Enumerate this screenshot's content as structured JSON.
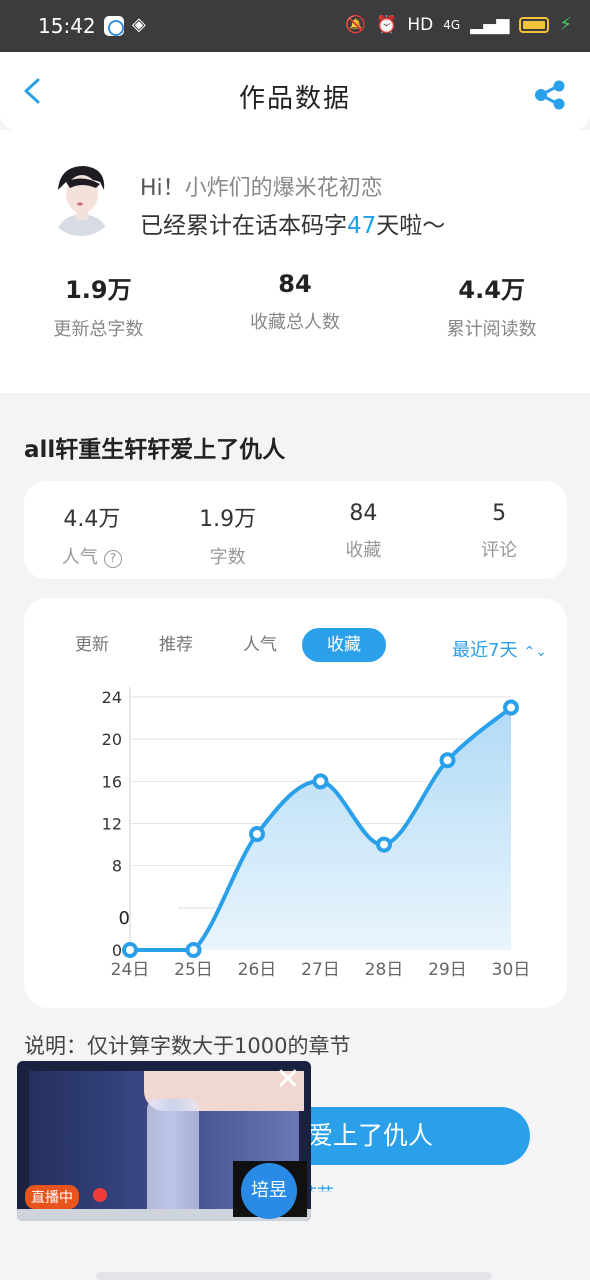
{
  "status_bar": {
    "time": "15:42",
    "network": "HD",
    "signal": "4G"
  },
  "nav": {
    "title": "作品数据"
  },
  "profile": {
    "greeting_prefix": "Hi！",
    "nickname": "小炸们的爆米花初恋",
    "days_prefix": "已经累计在话本码字",
    "days": "47",
    "days_suffix": "天啦～",
    "stats": [
      {
        "value": "1.9万",
        "label": "更新总字数"
      },
      {
        "value": "84",
        "label": "收藏总人数"
      },
      {
        "value": "4.4万",
        "label": "累计阅读数"
      }
    ]
  },
  "work": {
    "title": "all轩重生轩轩爱上了仇人",
    "stats": [
      {
        "value": "4.4万",
        "label": "人气"
      },
      {
        "value": "1.9万",
        "label": "字数"
      },
      {
        "value": "84",
        "label": "收藏"
      },
      {
        "value": "5",
        "label": "评论"
      }
    ]
  },
  "chart_tabs": [
    "更新",
    "推荐",
    "人气",
    "收藏"
  ],
  "active_tab": "收藏",
  "range_label": "最近7天",
  "chart_data": {
    "type": "area",
    "x": [
      "24日",
      "25日",
      "26日",
      "27日",
      "28日",
      "29日",
      "30日"
    ],
    "values": [
      0,
      0,
      11,
      16,
      10,
      18,
      23
    ],
    "y_ticks": [
      "24",
      "20",
      "16",
      "12",
      "8",
      "0",
      "0"
    ],
    "ylim": [
      0,
      24
    ],
    "grid": true,
    "color": "#2aa0ea"
  },
  "note": "说明：仅计算字数大于1000的章节",
  "button_label": "爱上了仇人",
  "link_text": "节节",
  "video": {
    "live_label": "直播中",
    "avatar_text": "培昱"
  }
}
